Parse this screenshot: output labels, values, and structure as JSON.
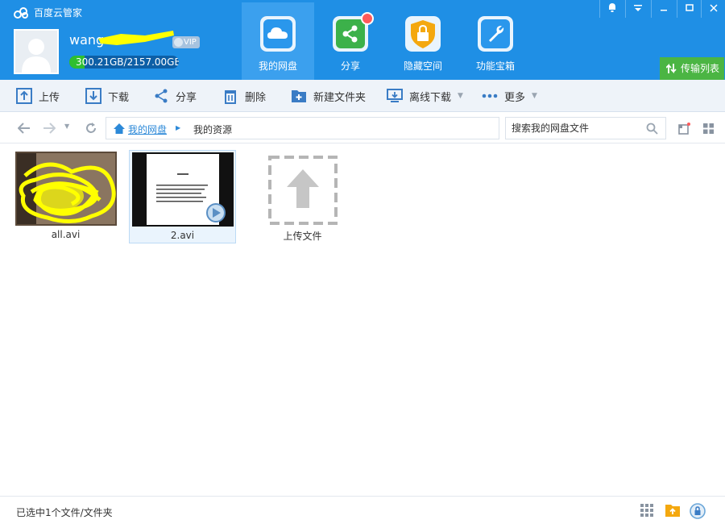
{
  "app": {
    "title": "百度云管家"
  },
  "user": {
    "name": "wang",
    "vip_label": "VIP",
    "quota_text": "300.21GB/2157.00GB",
    "quota_used_fraction": 0.14
  },
  "nav_tabs": [
    {
      "label": "我的网盘",
      "icon": "cloud-icon",
      "color": "#2a97ec",
      "active": true
    },
    {
      "label": "分享",
      "icon": "share-icon",
      "color": "#3cb14a",
      "active": false
    },
    {
      "label": "隐藏空间",
      "icon": "lock-icon",
      "color": "#f4a80f",
      "active": false
    },
    {
      "label": "功能宝箱",
      "icon": "wrench-icon",
      "color": "#2a97ec",
      "active": false
    }
  ],
  "transfer_list_label": "传输列表",
  "toolbar": {
    "upload": "上传",
    "download": "下载",
    "share": "分享",
    "delete": "删除",
    "new_folder": "新建文件夹",
    "offline_download": "离线下载",
    "more": "更多"
  },
  "breadcrumb": {
    "root": "我的网盘",
    "current": "我的资源"
  },
  "search": {
    "placeholder": "搜索我的网盘文件"
  },
  "files": [
    {
      "name": "all.avi",
      "type": "video",
      "selected": false
    },
    {
      "name": "2.avi",
      "type": "video",
      "selected": true
    },
    {
      "name": "上传文件",
      "type": "upload-placeholder",
      "selected": false
    }
  ],
  "status": {
    "text": "已选中1个文件/文件夹"
  },
  "colors": {
    "header": "#1f8fe5",
    "accent": "#2c89d8",
    "toolbar": "#eef3f9",
    "transfer": "#4bb543"
  }
}
